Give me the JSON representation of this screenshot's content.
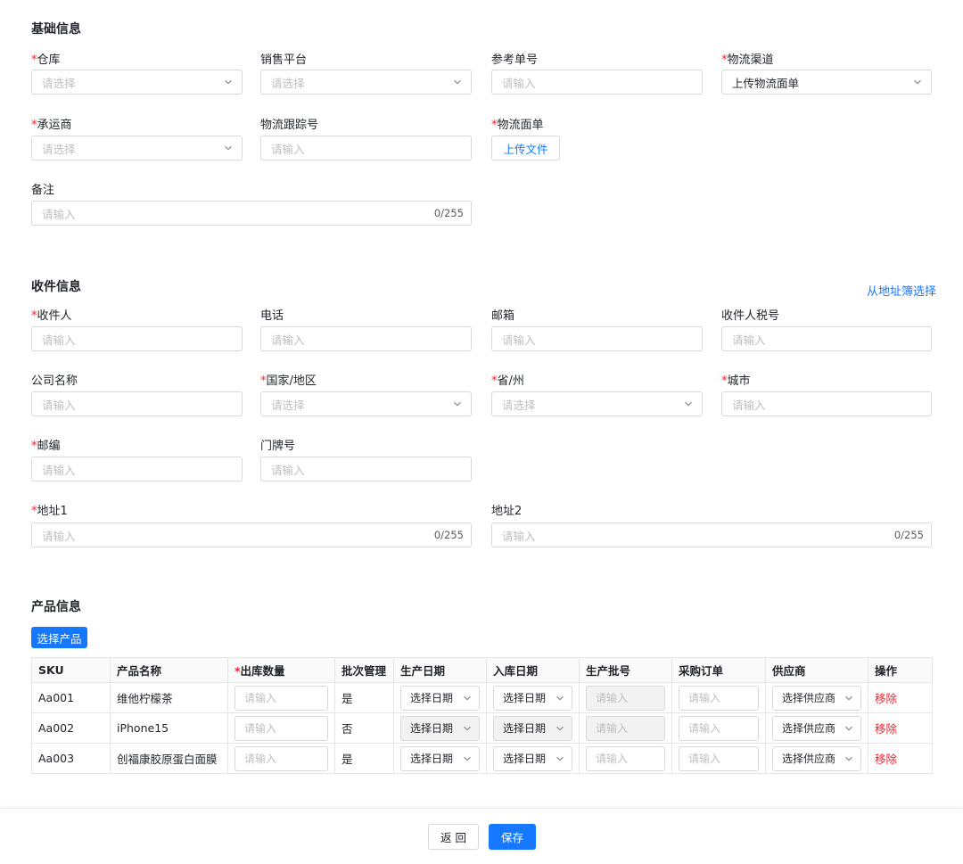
{
  "basic": {
    "title": "基础信息",
    "warehouse": {
      "label": "仓库",
      "placeholder": "请选择"
    },
    "platform": {
      "label": "销售平台",
      "placeholder": "请选择"
    },
    "ref_no": {
      "label": "参考单号",
      "placeholder": "请输入"
    },
    "channel": {
      "label": "物流渠道",
      "value": "上传物流面单"
    },
    "carrier": {
      "label": "承运商",
      "placeholder": "请选择"
    },
    "tracking": {
      "label": "物流跟踪号",
      "placeholder": "请输入"
    },
    "label_file": {
      "label": "物流面单",
      "button": "上传文件"
    },
    "remark": {
      "label": "备注",
      "placeholder": "请输入",
      "count": "0/255"
    }
  },
  "receiver": {
    "title": "收件信息",
    "address_book_link": "从地址簿选择",
    "name": {
      "label": "收件人",
      "placeholder": "请输入"
    },
    "phone": {
      "label": "电话",
      "placeholder": "请输入"
    },
    "email": {
      "label": "邮箱",
      "placeholder": "请输入"
    },
    "tax_no": {
      "label": "收件人税号",
      "placeholder": "请输入"
    },
    "company": {
      "label": "公司名称",
      "placeholder": "请输入"
    },
    "country": {
      "label": "国家/地区",
      "placeholder": "请选择"
    },
    "province": {
      "label": "省/州",
      "placeholder": "请选择"
    },
    "city": {
      "label": "城市",
      "placeholder": "请输入"
    },
    "zip": {
      "label": "邮编",
      "placeholder": "请输入"
    },
    "door_no": {
      "label": "门牌号",
      "placeholder": "请输入"
    },
    "address1": {
      "label": "地址1",
      "placeholder": "请输入",
      "count": "0/255"
    },
    "address2": {
      "label": "地址2",
      "placeholder": "请输入",
      "count": "0/255"
    }
  },
  "product": {
    "title": "产品信息",
    "select_button": "选择产品",
    "columns": {
      "sku": "SKU",
      "name": "产品名称",
      "qty": "出库数量",
      "batch": "批次管理",
      "prod_date": "生产日期",
      "in_date": "入库日期",
      "lot_no": "生产批号",
      "po": "采购订单",
      "supplier": "供应商",
      "action": "操作"
    },
    "rows": [
      {
        "sku": "Aa001",
        "name": "维他柠檬茶",
        "qty_ph": "请输入",
        "batch": "是",
        "prod_date": "选择日期",
        "in_date": "选择日期",
        "lot_ph": "请输入",
        "po_ph": "请输入",
        "supplier": "选择供应商",
        "action": "移除"
      },
      {
        "sku": "Aa002",
        "name": "iPhone15",
        "qty_ph": "请输入",
        "batch": "否",
        "prod_date": "选择日期",
        "in_date": "选择日期",
        "lot_ph": "请输入",
        "po_ph": "请输入",
        "supplier": "选择供应商",
        "action": "移除"
      },
      {
        "sku": "Aa003",
        "name": "创福康胶原蛋白面膜",
        "qty_ph": "请输入",
        "batch": "是",
        "prod_date": "选择日期",
        "in_date": "选择日期",
        "lot_ph": "请输入",
        "po_ph": "请输入",
        "supplier": "选择供应商",
        "action": "移除"
      }
    ]
  },
  "footer": {
    "back": "返 回",
    "save": "保存"
  },
  "colors": {
    "primary": "#1677ff",
    "required": "#f5222d",
    "border": "#d9d9d9"
  },
  "icons": {
    "dropdown": "chevron-down-icon"
  }
}
